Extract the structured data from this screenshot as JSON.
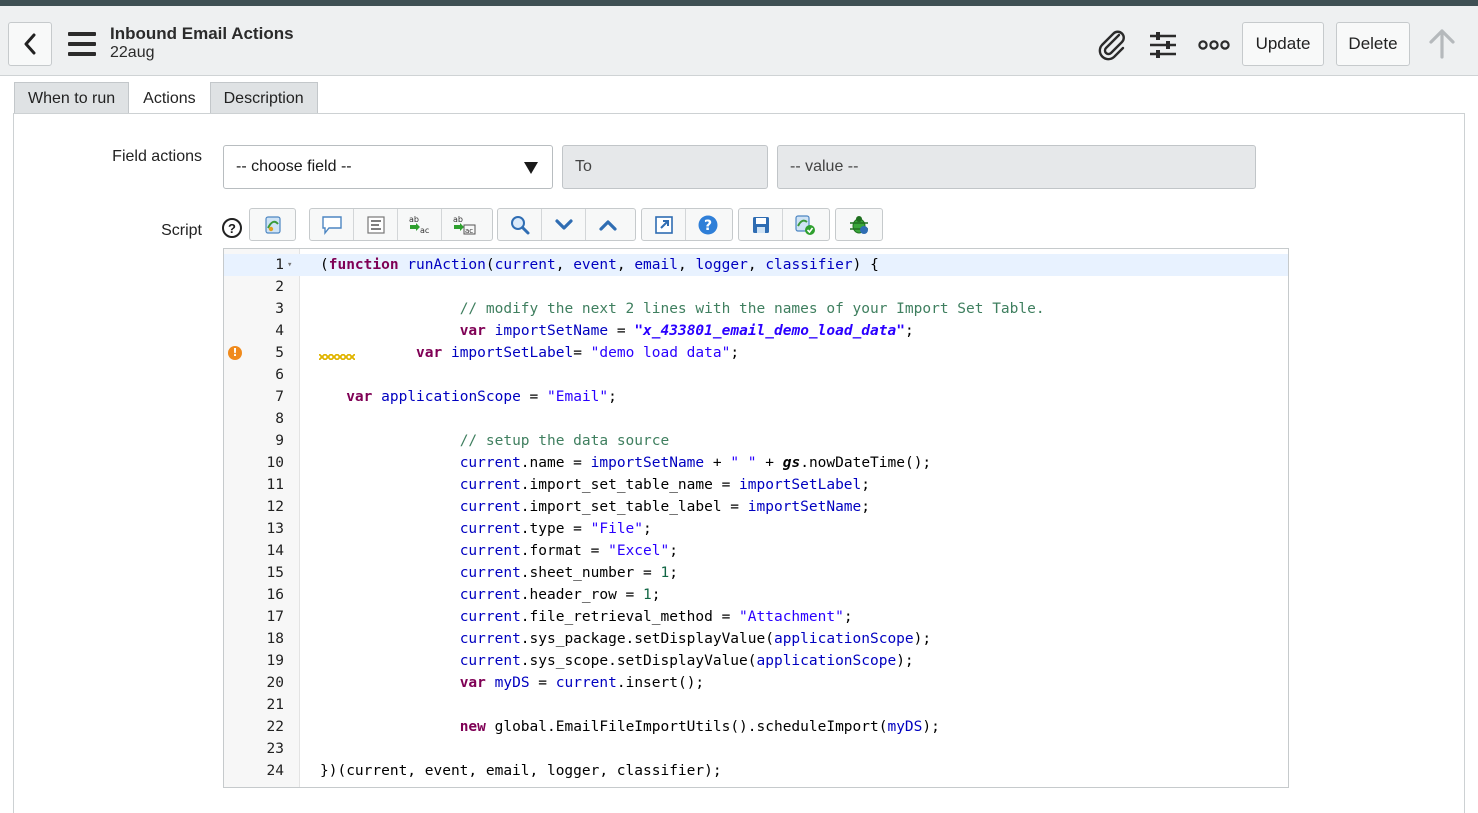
{
  "header": {
    "title": "Inbound Email Actions",
    "subtitle": "22aug",
    "update_label": "Update",
    "delete_label": "Delete",
    "icons": [
      "back-icon",
      "menu-icon",
      "paperclip-icon",
      "settings-sliders-icon",
      "more-icon",
      "scroll-up-icon"
    ]
  },
  "tabs": [
    {
      "label": "When to run",
      "active": false
    },
    {
      "label": "Actions",
      "active": true
    },
    {
      "label": "Description",
      "active": false
    }
  ],
  "field_actions": {
    "label": "Field actions",
    "field_select": "-- choose field --",
    "to_label": "To",
    "value_placeholder": "-- value --"
  },
  "script": {
    "label": "Script",
    "help_icon": "?",
    "toolbar_icons": [
      "script-include-icon",
      "comment-icon",
      "format-code-icon",
      "replace-icon",
      "replace-all-icon",
      "search-icon",
      "find-next-icon",
      "find-previous-icon",
      "fullscreen-icon",
      "help-icon",
      "save-icon",
      "syntax-check-icon",
      "debug-icon"
    ],
    "lines": [
      {
        "n": "1",
        "fold": true,
        "active": true,
        "warn": false,
        "tokens": [
          [
            "p",
            "("
          ],
          [
            "kw",
            "function"
          ],
          [
            "p",
            " "
          ],
          [
            "vr",
            "runAction"
          ],
          [
            "p",
            "("
          ],
          [
            "vr",
            "current"
          ],
          [
            "p",
            ", "
          ],
          [
            "vr",
            "event"
          ],
          [
            "p",
            ", "
          ],
          [
            "vr",
            "email"
          ],
          [
            "p",
            ", "
          ],
          [
            "vr",
            "logger"
          ],
          [
            "p",
            ", "
          ],
          [
            "vr",
            "classifier"
          ],
          [
            "p",
            ") {"
          ]
        ]
      },
      {
        "n": "2",
        "tokens": []
      },
      {
        "n": "3",
        "tokens": [
          [
            "p",
            "                "
          ],
          [
            "cm",
            "// modify the next 2 lines with the names of your Import Set Table."
          ]
        ]
      },
      {
        "n": "4",
        "tokens": [
          [
            "p",
            "                "
          ],
          [
            "kw",
            "var"
          ],
          [
            "p",
            " "
          ],
          [
            "vr",
            "importSetName"
          ],
          [
            "p",
            " = "
          ],
          [
            "sti",
            "\"x_433801_email_demo_load_data\""
          ],
          [
            "p",
            ";"
          ]
        ]
      },
      {
        "n": "5",
        "warn": true,
        "tokens": [
          [
            "p",
            "           "
          ],
          [
            "kw",
            "var"
          ],
          [
            "p",
            " "
          ],
          [
            "vr",
            "importSetLabel"
          ],
          [
            "p",
            "= "
          ],
          [
            "st",
            "\"demo load data\""
          ],
          [
            "p",
            ";"
          ]
        ]
      },
      {
        "n": "6",
        "tokens": []
      },
      {
        "n": "7",
        "tokens": [
          [
            "p",
            "   "
          ],
          [
            "kw",
            "var"
          ],
          [
            "p",
            " "
          ],
          [
            "vr",
            "applicationScope"
          ],
          [
            "p",
            " = "
          ],
          [
            "st",
            "\"Email\""
          ],
          [
            "p",
            ";"
          ]
        ]
      },
      {
        "n": "8",
        "tokens": []
      },
      {
        "n": "9",
        "tokens": [
          [
            "p",
            "                "
          ],
          [
            "cm",
            "// setup the data source"
          ]
        ]
      },
      {
        "n": "10",
        "tokens": [
          [
            "p",
            "                "
          ],
          [
            "vr",
            "current"
          ],
          [
            "p",
            ".name = "
          ],
          [
            "vr",
            "importSetName"
          ],
          [
            "p",
            " + "
          ],
          [
            "st",
            "\" \""
          ],
          [
            "p",
            " + "
          ],
          [
            "gs",
            "gs"
          ],
          [
            "p",
            ".nowDateTime();"
          ]
        ]
      },
      {
        "n": "11",
        "tokens": [
          [
            "p",
            "                "
          ],
          [
            "vr",
            "current"
          ],
          [
            "p",
            ".import_set_table_name = "
          ],
          [
            "vr",
            "importSetLabel"
          ],
          [
            "p",
            ";"
          ]
        ]
      },
      {
        "n": "12",
        "tokens": [
          [
            "p",
            "                "
          ],
          [
            "vr",
            "current"
          ],
          [
            "p",
            ".import_set_table_label = "
          ],
          [
            "vr",
            "importSetName"
          ],
          [
            "p",
            ";"
          ]
        ]
      },
      {
        "n": "13",
        "tokens": [
          [
            "p",
            "                "
          ],
          [
            "vr",
            "current"
          ],
          [
            "p",
            ".type = "
          ],
          [
            "st",
            "\"File\""
          ],
          [
            "p",
            ";"
          ]
        ]
      },
      {
        "n": "14",
        "tokens": [
          [
            "p",
            "                "
          ],
          [
            "vr",
            "current"
          ],
          [
            "p",
            ".format = "
          ],
          [
            "st",
            "\"Excel\""
          ],
          [
            "p",
            ";"
          ]
        ]
      },
      {
        "n": "15",
        "tokens": [
          [
            "p",
            "                "
          ],
          [
            "vr",
            "current"
          ],
          [
            "p",
            ".sheet_number = "
          ],
          [
            "nm",
            "1"
          ],
          [
            "p",
            ";"
          ]
        ]
      },
      {
        "n": "16",
        "tokens": [
          [
            "p",
            "                "
          ],
          [
            "vr",
            "current"
          ],
          [
            "p",
            ".header_row = "
          ],
          [
            "nm",
            "1"
          ],
          [
            "p",
            ";"
          ]
        ]
      },
      {
        "n": "17",
        "tokens": [
          [
            "p",
            "                "
          ],
          [
            "vr",
            "current"
          ],
          [
            "p",
            ".file_retrieval_method = "
          ],
          [
            "st",
            "\"Attachment\""
          ],
          [
            "p",
            ";"
          ]
        ]
      },
      {
        "n": "18",
        "tokens": [
          [
            "p",
            "                "
          ],
          [
            "vr",
            "current"
          ],
          [
            "p",
            ".sys_package.setDisplayValue("
          ],
          [
            "vr",
            "applicationScope"
          ],
          [
            "p",
            ");"
          ]
        ]
      },
      {
        "n": "19",
        "tokens": [
          [
            "p",
            "                "
          ],
          [
            "vr",
            "current"
          ],
          [
            "p",
            ".sys_scope.setDisplayValue("
          ],
          [
            "vr",
            "applicationScope"
          ],
          [
            "p",
            ");"
          ]
        ]
      },
      {
        "n": "20",
        "tokens": [
          [
            "p",
            "                "
          ],
          [
            "kw",
            "var"
          ],
          [
            "p",
            " "
          ],
          [
            "vr",
            "myDS"
          ],
          [
            "p",
            " = "
          ],
          [
            "vr",
            "current"
          ],
          [
            "p",
            ".insert();"
          ]
        ]
      },
      {
        "n": "21",
        "tokens": []
      },
      {
        "n": "22",
        "tokens": [
          [
            "p",
            "                "
          ],
          [
            "kw",
            "new"
          ],
          [
            "p",
            " global.EmailFileImportUtils().scheduleImport("
          ],
          [
            "vr",
            "myDS"
          ],
          [
            "p",
            ");"
          ]
        ]
      },
      {
        "n": "23",
        "tokens": []
      },
      {
        "n": "24",
        "tokens": [
          [
            "p",
            "})(current, event, email, logger, classifier);"
          ]
        ]
      }
    ]
  }
}
